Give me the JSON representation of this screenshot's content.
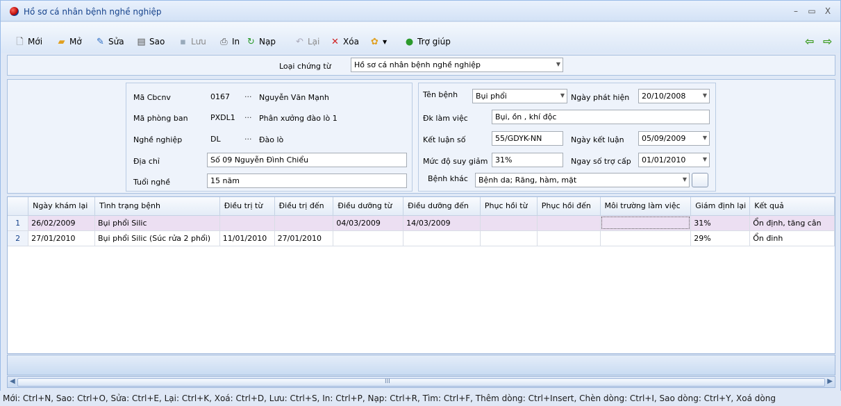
{
  "window": {
    "title": "Hồ sơ cá nhân bệnh nghề nghiệp",
    "min": "–",
    "max": "▭",
    "close": "X"
  },
  "toolbar": {
    "new": "Mới",
    "open": "Mở",
    "edit": "Sửa",
    "copy": "Sao",
    "save": "Lưu",
    "print": "In",
    "reload": "Nạp",
    "undo": "Lại",
    "delete": "Xóa",
    "help": "Trợ giúp"
  },
  "doc_type": {
    "label": "Loại chứng từ",
    "value": "Hồ sơ cá nhân bệnh nghề nghiệp"
  },
  "employee": {
    "code_label": "Mã Cbcnv",
    "code": "0167",
    "name": "Nguyễn Văn Mạnh",
    "dept_label": "Mã phòng ban",
    "dept_code": "PXDL1",
    "dept_name": "Phân xưởng đào lò 1",
    "job_label": "Nghề nghiệp",
    "job_code": "DL",
    "job_name": "Đào lò",
    "address_label": "Địa chỉ",
    "address": "Số 09 Nguyễn Đình Chiểu",
    "seniority_label": "Tuổi nghề",
    "seniority": "15 năm",
    "dots": "···"
  },
  "disease": {
    "name_label": "Tên bệnh",
    "name": "Bụi phổi",
    "found_label": "Ngày phát hiện",
    "found_date": "20/10/2008",
    "work_label": "Đk làm việc",
    "work": "Bụi, ồn , khí độc",
    "concl_label": "Kết luận số",
    "concl_no": "55/GDYK-NN",
    "concl_date_label": "Ngày kết luận",
    "concl_date": "05/09/2009",
    "decline_label": "Mức độ suy giảm",
    "decline": "31%",
    "allow_label": "Ngay số trợ cấp",
    "allow_date": "01/01/2010",
    "other_label": "Bệnh khác",
    "other": "Bệnh da; Răng, hàm, mặt"
  },
  "table": {
    "columns": [
      "Ngày khám lại",
      "Tình trạng bệnh",
      "Điều trị từ",
      "Điều trị đến",
      "Điều dưỡng từ",
      "Điều dưỡng đến",
      "Phục hồi từ",
      "Phục hồi đến",
      "Môi trường làm việc",
      "Giám định lại",
      "Kết quả"
    ],
    "rows": [
      {
        "n": "1",
        "cells": [
          "26/02/2009",
          "Bụi phổi Silic",
          "",
          "",
          "04/03/2009",
          "14/03/2009",
          "",
          "",
          "",
          "31%",
          "Ổn định, tăng cân"
        ]
      },
      {
        "n": "2",
        "cells": [
          "27/01/2010",
          "Bụi phổi Silic (Súc rửa 2 phổi)",
          "11/01/2010",
          "27/01/2010",
          "",
          "",
          "",
          "",
          "",
          "29%",
          "Ổn đinh"
        ]
      }
    ]
  },
  "scroll": {
    "grip": "III"
  },
  "status": "Mới: Ctrl+N, Sao: Ctrl+O, Sửa: Ctrl+E, Lại: Ctrl+K, Xoá: Ctrl+D, Lưu: Ctrl+S, In: Ctrl+P, Nạp: Ctrl+R, Tìm: Ctrl+F, Thêm dòng: Ctrl+Insert, Chèn dòng: Ctrl+I, Sao dòng: Ctrl+Y, Xoá dòng"
}
